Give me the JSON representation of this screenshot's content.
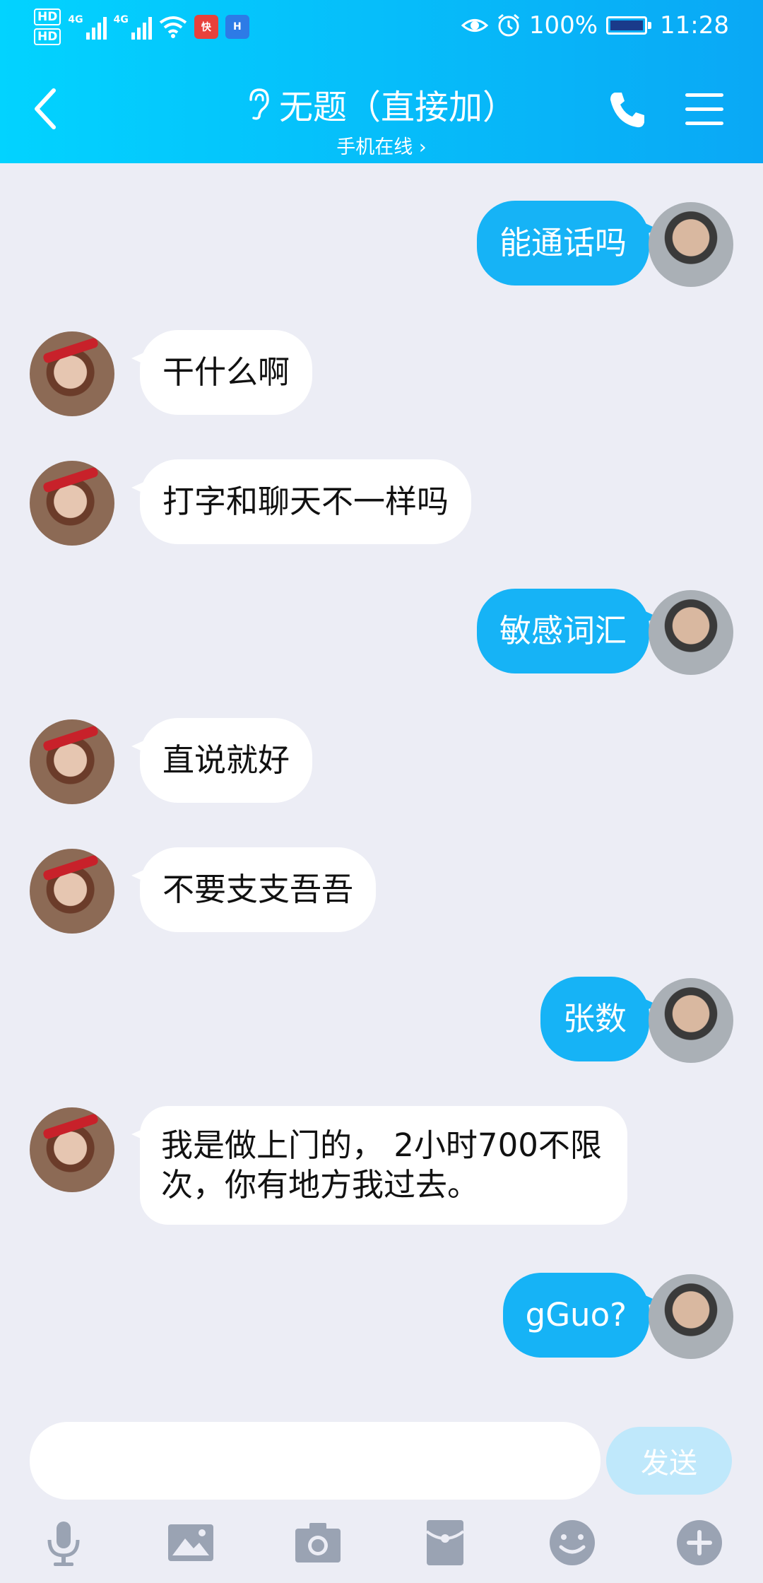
{
  "status_bar": {
    "hd1": "HD",
    "hd2": "HD",
    "net1": "4G",
    "net2": "4G",
    "app_badge_1": "快",
    "app_badge_2": "H",
    "battery": "100%",
    "time": "11:28"
  },
  "header": {
    "title": "无题（直接加）",
    "subtitle": "手机在线 ›"
  },
  "messages": [
    {
      "from": "me",
      "text": "能通话吗"
    },
    {
      "from": "her",
      "text": "干什么啊"
    },
    {
      "from": "her",
      "text": "打字和聊天不一样吗"
    },
    {
      "from": "me",
      "text": "敏感词汇"
    },
    {
      "from": "her",
      "text": "直说就好"
    },
    {
      "from": "her",
      "text": "不要支支吾吾"
    },
    {
      "from": "me",
      "text": "张数"
    },
    {
      "from": "her",
      "text": "我是做上门的， 2小时700不限次，你有地方我过去。"
    },
    {
      "from": "me",
      "text": "gGuo?"
    }
  ],
  "input": {
    "value": "",
    "send_label": "发送"
  },
  "colors": {
    "header_start": "#02d3ff",
    "header_end": "#0aa8f5",
    "sent_bubble": "#16b3f6",
    "received_bubble": "#ffffff",
    "background": "#ecedf5"
  },
  "toolbar_icons": [
    "microphone-icon",
    "image-icon",
    "camera-icon",
    "red-packet-icon",
    "emoji-icon",
    "plus-icon"
  ]
}
